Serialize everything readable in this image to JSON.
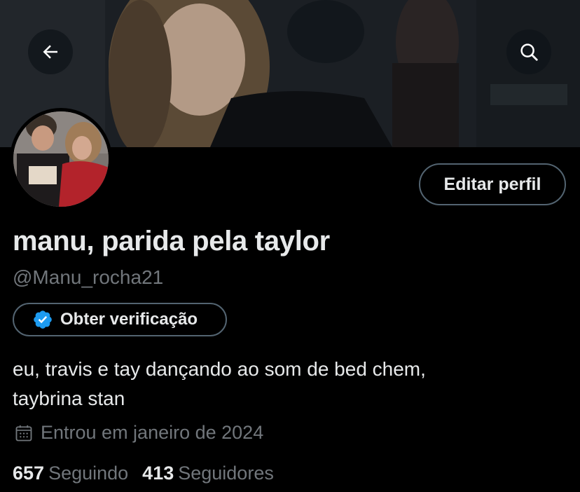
{
  "header": {
    "back_icon": "arrow-left-icon",
    "search_icon": "search-icon"
  },
  "profile": {
    "display_name": "manu, parida pela taylor",
    "handle": "@Manu_rocha21",
    "edit_label": "Editar perfil",
    "verify_label": "Obter verificação",
    "verify_icon": "verified-badge-icon",
    "bio_lines": [
      "eu, travis e tay dançando ao som de bed chem,",
      "taybrina stan"
    ],
    "joined_icon": "calendar-icon",
    "joined": "Entrou em janeiro de 2024",
    "following_count": "657",
    "following_label": "Seguindo",
    "followers_count": "413",
    "followers_label": "Seguidores"
  },
  "colors": {
    "background": "#000000",
    "primary_text": "#e7e9ea",
    "secondary_text": "#71767b",
    "border": "#536471",
    "verified_blue": "#1d9bf0"
  }
}
